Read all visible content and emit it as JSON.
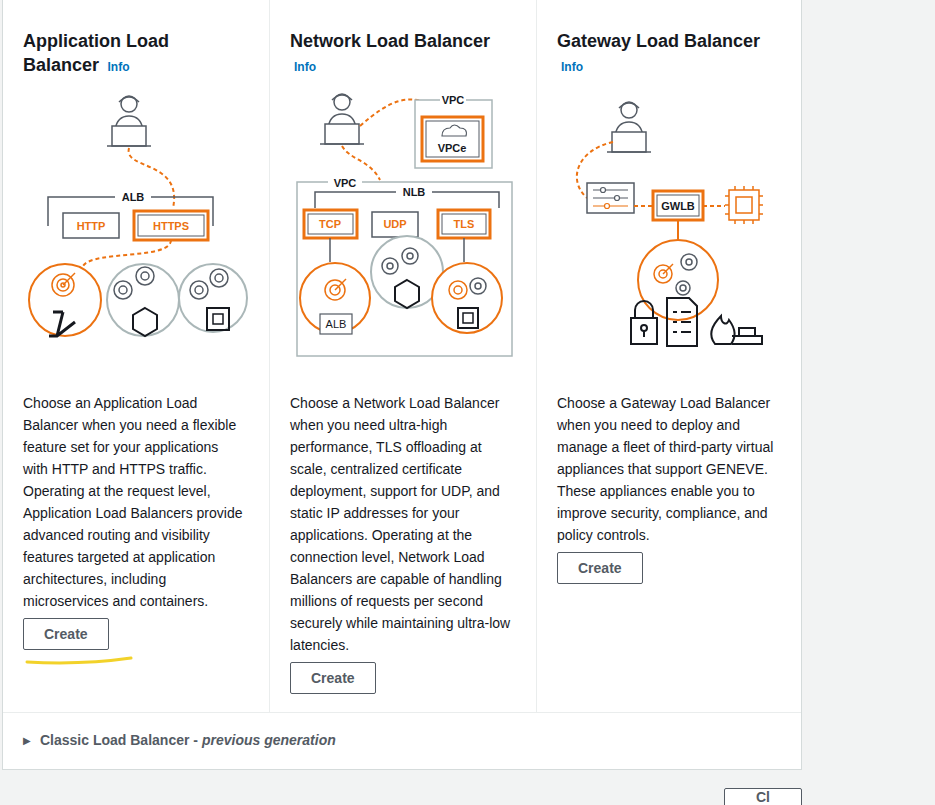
{
  "cards": [
    {
      "title": "Application Load Balancer",
      "info": "Info",
      "description": "Choose an Application Load Balancer when you need a flexible feature set for your applications with HTTP and HTTPS traffic. Operating at the request level, Application Load Balancers provide advanced routing and visibility features targeted at application architectures, including microservices and containers.",
      "button": "Create",
      "annotated": true,
      "diagram": {
        "alb": "ALB",
        "http": "HTTP",
        "https": "HTTPS"
      }
    },
    {
      "title": "Network Load Balancer",
      "info": "Info",
      "description": "Choose a Network Load Balancer when you need ultra-high performance, TLS offloading at scale, centralized certificate deployment, support for UDP, and static IP addresses for your applications. Operating at the connection level, Network Load Balancers are capable of handling millions of requests per second securely while maintaining ultra-low latencies.",
      "button": "Create",
      "annotated": false,
      "diagram": {
        "vpc_top": "VPC",
        "vpce": "VPCe",
        "vpc": "VPC",
        "nlb": "NLB",
        "tcp": "TCP",
        "udp": "UDP",
        "tls": "TLS",
        "alb": "ALB"
      }
    },
    {
      "title": "Gateway Load Balancer",
      "info": "Info",
      "description": "Choose a Gateway Load Balancer when you need to deploy and manage a fleet of third-party virtual appliances that support GENEVE. These appliances enable you to improve security, compliance, and policy controls.",
      "button": "Create",
      "annotated": false,
      "diagram": {
        "gwlb": "GWLB"
      }
    }
  ],
  "classic": {
    "arrow": "▶",
    "label": "Classic Load Balancer -",
    "label_em": "previous generation",
    "expanded": false
  },
  "footer_button": "Cl"
}
